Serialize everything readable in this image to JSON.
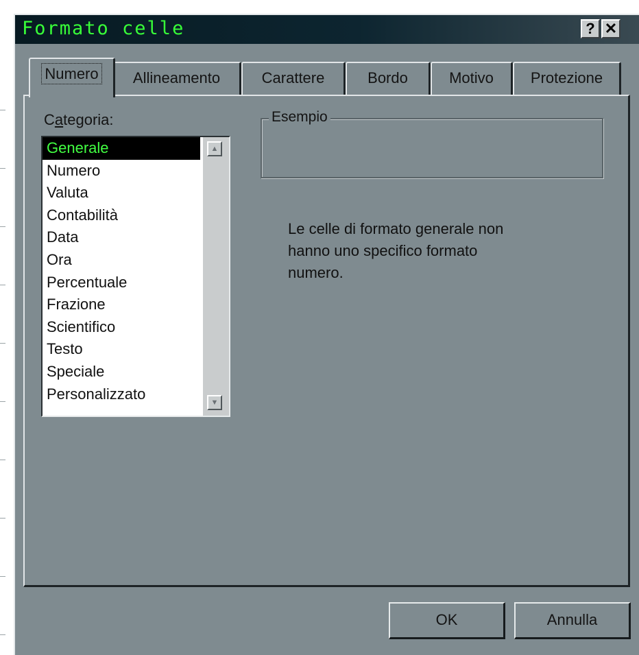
{
  "dialog": {
    "title": "Formato celle",
    "help_button": "?",
    "close_button": "✕"
  },
  "tabs": [
    {
      "label": "Numero",
      "active": true
    },
    {
      "label": "Allineamento",
      "active": false
    },
    {
      "label": "Carattere",
      "active": false
    },
    {
      "label": "Bordo",
      "active": false
    },
    {
      "label": "Motivo",
      "active": false
    },
    {
      "label": "Protezione",
      "active": false
    }
  ],
  "category": {
    "label_prefix": "C",
    "label_underlined": "a",
    "label_suffix": "tegoria:",
    "items": [
      "Generale",
      "Numero",
      "Valuta",
      "Contabilità",
      "Data",
      "Ora",
      "Percentuale",
      "Frazione",
      "Scientifico",
      "Testo",
      "Speciale",
      "Personalizzato"
    ],
    "selected": "Generale"
  },
  "example": {
    "legend": "Esempio",
    "value": ""
  },
  "description": [
    "Le celle di formato generale non",
    "hanno uno specifico formato",
    "numero."
  ],
  "buttons": {
    "ok": "OK",
    "cancel": "Annulla"
  },
  "colors": {
    "dialog_face": "#7f8b90",
    "title_text": "#38ff38",
    "selected_item_text": "#42ff42"
  }
}
